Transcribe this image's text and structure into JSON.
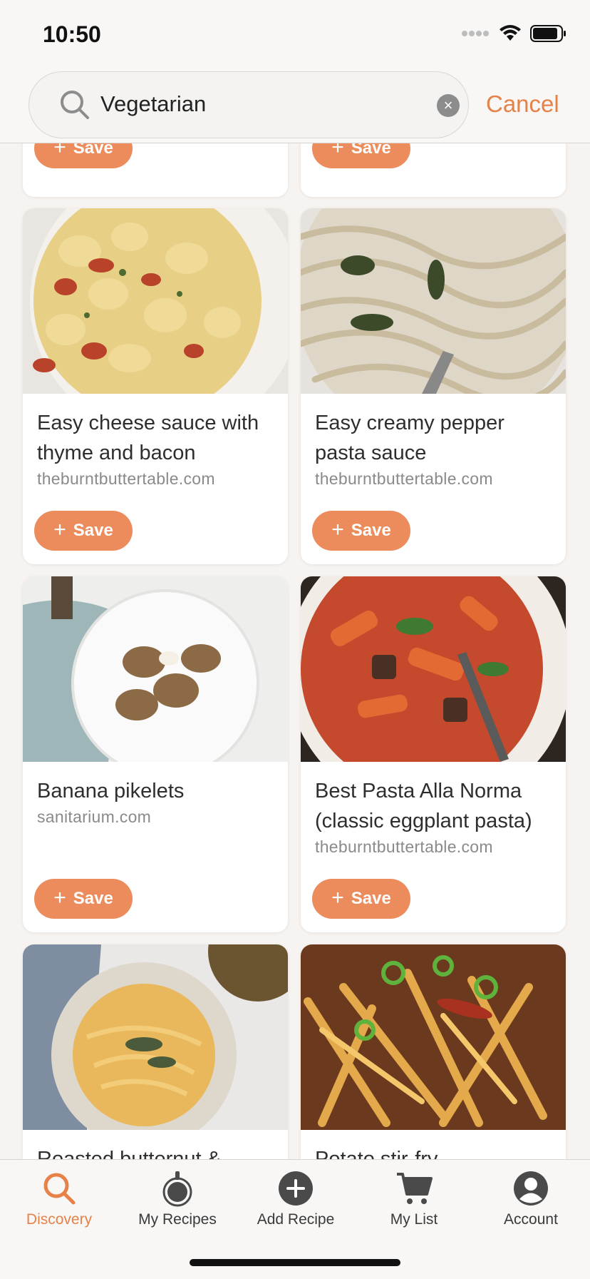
{
  "status_bar": {
    "time": "10:50"
  },
  "search": {
    "value": "Vegetarian",
    "placeholder": "Search",
    "cancel_label": "Cancel"
  },
  "save_label": "Save",
  "cards": [
    {
      "title": "",
      "source": ""
    },
    {
      "title": "",
      "source": ""
    },
    {
      "title": "Easy cheese sauce with thyme and bacon",
      "source": "theburntbuttertable.com"
    },
    {
      "title": "Easy creamy pepper pasta sauce",
      "source": "theburntbuttertable.com"
    },
    {
      "title": "Banana pikelets",
      "source": "sanitarium.com"
    },
    {
      "title": "Best Pasta Alla Norma (classic eggplant pasta)",
      "source": "theburntbuttertable.com"
    },
    {
      "title": "Roasted butternut &",
      "source": ""
    },
    {
      "title": "Potato stir-fry",
      "source": ""
    }
  ],
  "tabs": [
    {
      "label": "Discovery",
      "icon": "search-icon",
      "active": true
    },
    {
      "label": "My Recipes",
      "icon": "pot-icon",
      "active": false
    },
    {
      "label": "Add Recipe",
      "icon": "plus-circle-icon",
      "active": false
    },
    {
      "label": "My List",
      "icon": "cart-icon",
      "active": false
    },
    {
      "label": "Account",
      "icon": "person-icon",
      "active": false
    }
  ],
  "colors": {
    "accent": "#ec8c5c",
    "accent_text": "#e68148",
    "background": "#f6f3f1"
  }
}
